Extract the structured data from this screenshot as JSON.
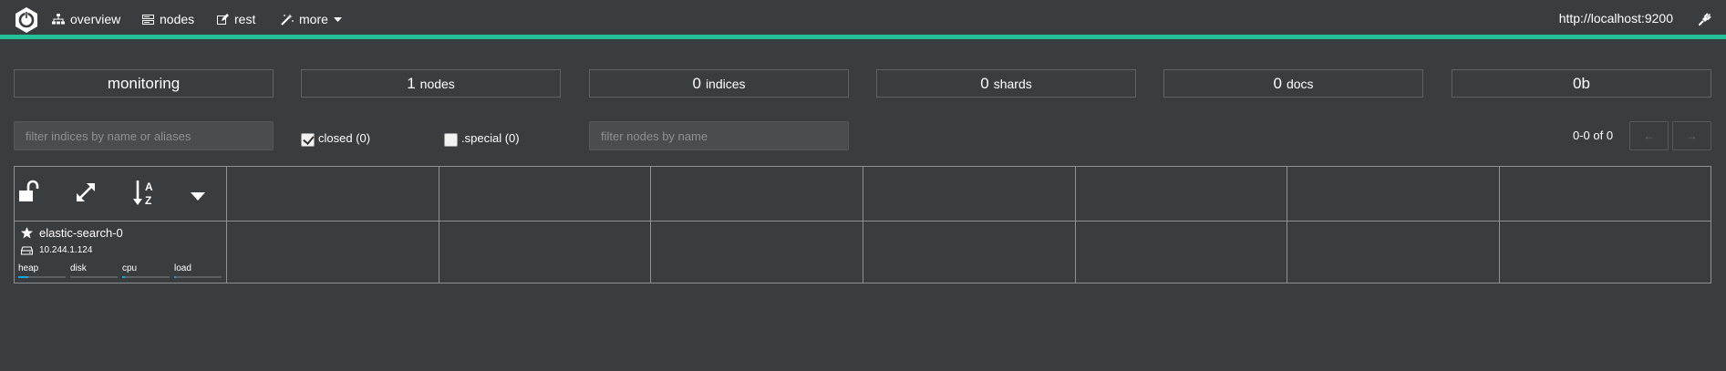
{
  "navbar": {
    "overview_label": "overview",
    "nodes_label": "nodes",
    "rest_label": "rest",
    "more_label": "more",
    "host": "http://localhost:9200"
  },
  "stats": {
    "cluster_name": "monitoring",
    "nodes_count": "1",
    "nodes_label": "nodes",
    "indices_count": "0",
    "indices_label": "indices",
    "shards_count": "0",
    "shards_label": "shards",
    "docs_count": "0",
    "docs_label": "docs",
    "size": "0b"
  },
  "filters": {
    "indices_placeholder": "filter indices by name or aliases",
    "closed_label": "closed (0)",
    "closed_checked": true,
    "special_label": ".special (0)",
    "special_checked": false,
    "nodes_placeholder": "filter nodes by name"
  },
  "pager": {
    "range_text": "0-0 of 0",
    "prev_label": "←",
    "next_label": "→"
  },
  "node": {
    "name": "elastic-search-0",
    "ip": "10.244.1.124",
    "metrics": [
      {
        "label": "heap",
        "fraction": 0.22
      },
      {
        "label": "disk",
        "fraction": 0.0
      },
      {
        "label": "cpu",
        "fraction": 0.05
      },
      {
        "label": "load",
        "fraction": 0.04
      }
    ]
  },
  "colors": {
    "accent": "#23c197",
    "background": "#3a3d40",
    "metric_fill": "#1aa5dc"
  },
  "icons": [
    "logo-icon",
    "sitemap-icon",
    "server-icon",
    "edit-icon",
    "magic-wand-icon",
    "caret-down-icon",
    "plug-icon",
    "unlock-icon",
    "expand-icon",
    "sort-alpha-icon",
    "star-icon",
    "hdd-icon"
  ]
}
